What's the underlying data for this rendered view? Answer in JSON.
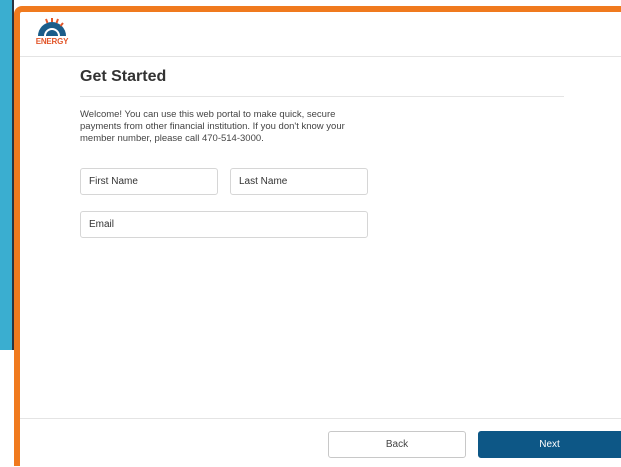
{
  "brand": {
    "logo_text": "ENERGY",
    "colors": {
      "orange": "#f07a1e",
      "navy": "#0d5786",
      "blue_strip": "#3aaed0"
    }
  },
  "form": {
    "title": "Get Started",
    "welcome": "Welcome! You can use this web portal to make quick, secure payments from other financial institution. If you don't know your member number, please call 470-514-3000.",
    "first_name_placeholder": "First Name",
    "last_name_placeholder": "Last Name",
    "email_placeholder": "Email"
  },
  "footer": {
    "back_label": "Back",
    "next_label": "Next"
  }
}
